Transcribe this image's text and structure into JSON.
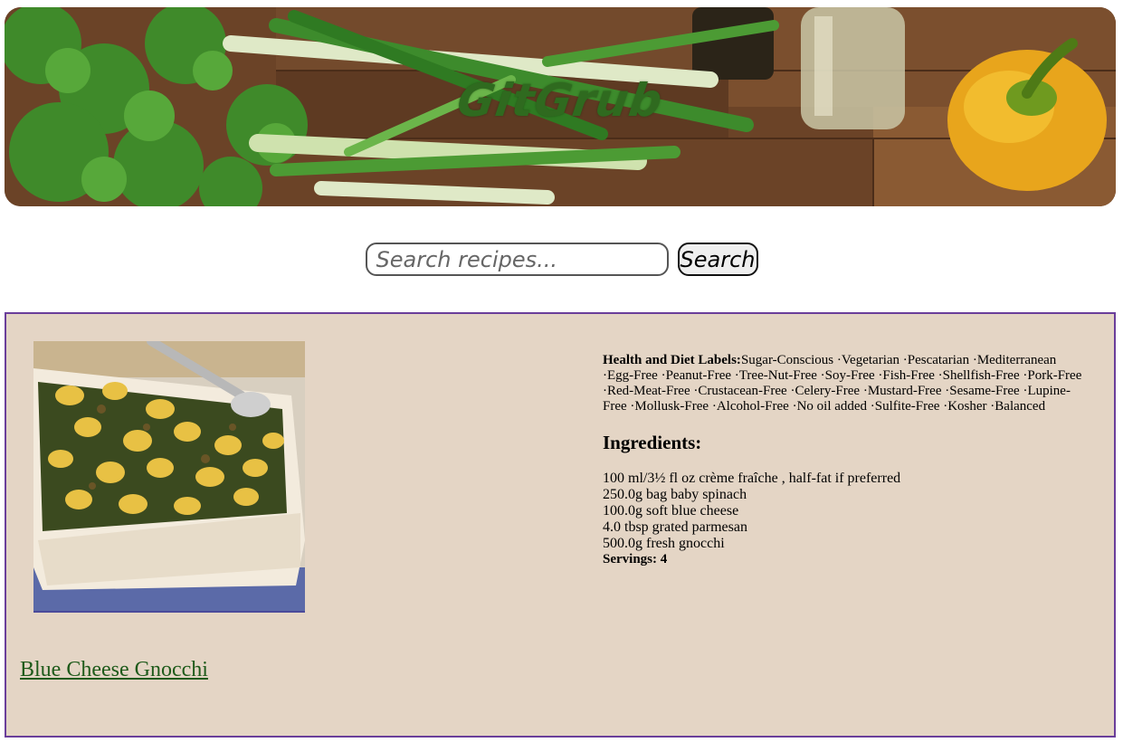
{
  "header": {
    "brand": "GitGrub"
  },
  "search": {
    "placeholder": "Search recipes...",
    "value": "",
    "button_label": "Search"
  },
  "result": {
    "title": "Blue Cheese Gnocchi",
    "health_label_heading": "Health and Diet Labels:",
    "health_labels": [
      "Sugar-Conscious",
      "Vegetarian",
      "Pescatarian",
      "Mediterranean",
      "Egg-Free",
      "Peanut-Free",
      "Tree-Nut-Free",
      "Soy-Free",
      "Fish-Free",
      "Shellfish-Free",
      "Pork-Free",
      "Red-Meat-Free",
      "Crustacean-Free",
      "Celery-Free",
      "Mustard-Free",
      "Sesame-Free",
      "Lupine-Free",
      "Mollusk-Free",
      "Alcohol-Free",
      "No oil added",
      "Sulfite-Free",
      "Kosher",
      "Balanced"
    ],
    "ingredients_heading": "Ingredients:",
    "ingredients": [
      "100 ml/3½ fl oz crème fraîche , half-fat if preferred",
      "250.0g bag baby spinach",
      "100.0g soft blue cheese",
      "4.0 tbsp grated parmesan",
      "500.0g fresh gnocchi"
    ],
    "servings": "Servings: 4"
  },
  "colors": {
    "card_background": "#e4d5c5",
    "card_border": "#6a3e9a",
    "title_link": "#1e5a1a",
    "brand": "#2f6a1f"
  }
}
